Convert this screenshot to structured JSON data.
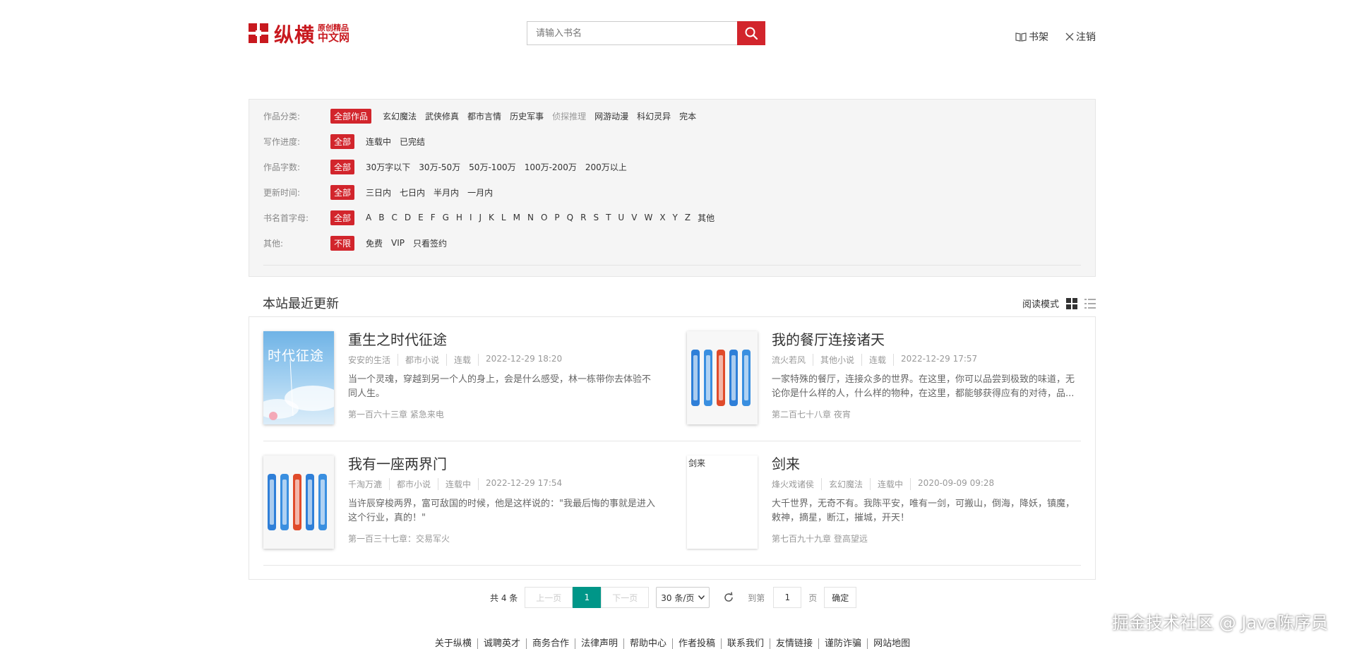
{
  "header": {
    "logo_main": "纵横",
    "logo_sub1": "原创精品",
    "logo_sub2": "中文网",
    "search_placeholder": "请输入书名",
    "links": [
      "书架",
      "注销"
    ]
  },
  "filters": [
    {
      "label": "作品分类:",
      "options": [
        "全部作品",
        "玄幻魔法",
        "武侠修真",
        "都市言情",
        "历史军事",
        "侦探推理",
        "网游动漫",
        "科幻灵异",
        "完本"
      ],
      "active": 0,
      "dim": [
        5
      ]
    },
    {
      "label": "写作进度:",
      "options": [
        "全部",
        "连载中",
        "已完结"
      ],
      "active": 0,
      "dim": []
    },
    {
      "label": "作品字数:",
      "options": [
        "全部",
        "30万字以下",
        "30万-50万",
        "50万-100万",
        "100万-200万",
        "200万以上"
      ],
      "active": 0,
      "dim": []
    },
    {
      "label": "更新时间:",
      "options": [
        "全部",
        "三日内",
        "七日内",
        "半月内",
        "一月内"
      ],
      "active": 0,
      "dim": []
    },
    {
      "label": "书名首字母:",
      "options": [
        "全部",
        "A",
        "B",
        "C",
        "D",
        "E",
        "F",
        "G",
        "H",
        "I",
        "J",
        "K",
        "L",
        "M",
        "N",
        "O",
        "P",
        "Q",
        "R",
        "S",
        "T",
        "U",
        "V",
        "W",
        "X",
        "Y",
        "Z",
        "其他"
      ],
      "active": 0,
      "dim": []
    },
    {
      "label": "其他:",
      "options": [
        "不限",
        "免费",
        "VIP",
        "只看签约"
      ],
      "active": 0,
      "dim": []
    }
  ],
  "section": {
    "title": "本站最近更新",
    "read_mode": "阅读模式"
  },
  "books": [
    {
      "title": "重生之时代征途",
      "author": "安安的生活",
      "category": "都市小说",
      "status": "连载",
      "time": "2022-12-29 18:20",
      "desc": "当一个灵魂，穿越到另一个人的身上，会是什么感受，林一栋带你去体验不同人生。",
      "latest": "第一百六十三章 紧急来电",
      "cover": "sky",
      "cover_text": "时代征途"
    },
    {
      "title": "我的餐厅连接诸天",
      "author": "流火若风",
      "category": "其他小说",
      "status": "连载",
      "time": "2022-12-29 17:57",
      "desc": "一家特殊的餐厅，连接众多的世界。在这里，你可以品尝到极致的味道，无论你是什么样的人，什么样的物种，在这里，都能够获得应有的对待，品...",
      "latest": "第二百七十八章 夜宵",
      "cover": "placeholder",
      "cover_text": ""
    },
    {
      "title": "我有一座两界门",
      "author": "千淘万漉",
      "category": "都市小说",
      "status": "连载中",
      "time": "2022-12-29 17:54",
      "desc": "当许辰穿梭两界，富可敌国的时候，他是这样说的：\"我最后悔的事就是进入这个行业，真的！\"",
      "latest": "第一百三十七章：交易军火",
      "cover": "placeholder",
      "cover_text": ""
    },
    {
      "title": "剑来",
      "author": "烽火戏诸侯",
      "category": "玄幻魔法",
      "status": "连载中",
      "time": "2020-09-09 09:28",
      "desc": "大千世界，无奇不有。我陈平安，唯有一剑，可搬山，倒海，降妖，镇魔，敕神，摘星，断江，摧城，开天！",
      "latest": "第七百九十九章 登高望远",
      "cover": "broken",
      "cover_text": "剑来"
    }
  ],
  "pager": {
    "total": "共 4 条",
    "prev": "上一页",
    "current": "1",
    "next": "下一页",
    "page_size": "30 条/页",
    "goto_label": "到第",
    "goto_value": "1",
    "page_unit": "页",
    "confirm": "确定"
  },
  "footer": {
    "links": [
      "关于纵横",
      "诚聘英才",
      "商务合作",
      "法律声明",
      "帮助中心",
      "作者投稿",
      "联系我们",
      "友情链接",
      "谨防诈骗",
      "网站地图"
    ]
  },
  "watermark": "掘金技术社区 @ Java陈序员",
  "colors": {
    "accent": "#d2252c",
    "pager_active": "#009688"
  }
}
